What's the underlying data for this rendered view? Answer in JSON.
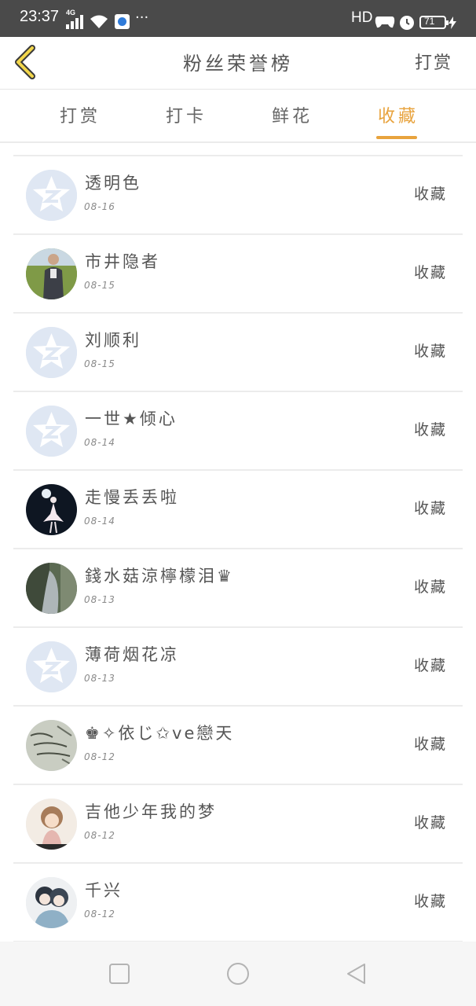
{
  "status_bar": {
    "time": "23:37",
    "network": "4G",
    "more": "···",
    "hd": "HD",
    "battery": "71",
    "icons": [
      "signal-icon",
      "wifi-icon",
      "app-notification-icon",
      "gamepad-icon",
      "alarm-icon",
      "battery-icon",
      "charging-icon"
    ]
  },
  "header": {
    "title": "粉丝荣誉榜",
    "action": "打赏",
    "back_icon": "chevron-left-icon",
    "accent_color": "#e8a33d"
  },
  "tabs": [
    {
      "label": "打赏",
      "active": false
    },
    {
      "label": "打卡",
      "active": false
    },
    {
      "label": "鲜花",
      "active": false
    },
    {
      "label": "收藏",
      "active": true
    }
  ],
  "fans": [
    {
      "name": "透明色",
      "date": "08-16",
      "action": "收藏",
      "avatar": "default"
    },
    {
      "name": "市井隐者",
      "date": "08-15",
      "action": "收藏",
      "avatar": "photo-man"
    },
    {
      "name": "刘顺利",
      "date": "08-15",
      "action": "收藏",
      "avatar": "default"
    },
    {
      "name": "一世★倾心",
      "date": "08-14",
      "action": "收藏",
      "avatar": "default"
    },
    {
      "name": "走慢丢丢啦",
      "date": "08-14",
      "action": "收藏",
      "avatar": "photo-dancer"
    },
    {
      "name": "錢水菇涼檸檬泪♛",
      "date": "08-13",
      "action": "收藏",
      "avatar": "photo-scenery"
    },
    {
      "name": "薄荷烟花凉",
      "date": "08-13",
      "action": "收藏",
      "avatar": "default"
    },
    {
      "name": "♚✧依じ✩ve戀天",
      "date": "08-12",
      "action": "收藏",
      "avatar": "photo-handwriting"
    },
    {
      "name": "吉他少年我的梦",
      "date": "08-12",
      "action": "收藏",
      "avatar": "photo-anime-girl"
    },
    {
      "name": "千兴",
      "date": "08-12",
      "action": "收藏",
      "avatar": "photo-anime-pair"
    }
  ],
  "nav_bar": {
    "icons": [
      "recent-apps-square-icon",
      "home-circle-icon",
      "back-triangle-icon"
    ]
  }
}
